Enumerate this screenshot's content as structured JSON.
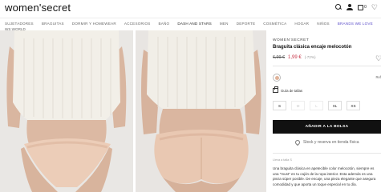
{
  "header": {
    "logo": "women'secret",
    "bag_count": "0"
  },
  "nav": {
    "items": [
      "SUJETADORES",
      "BRAGUITAS",
      "DORMIR Y HOMEWEAR",
      "ACCESORIOS",
      "BAÑO",
      "DASH AND STARS",
      "MEN",
      "DEPORTE",
      "COSMÉTICA",
      "HOGAR",
      "NIÑOS",
      "BRANDS WE LOVE"
    ],
    "second_line": "WS WORLD"
  },
  "product": {
    "brand": "WOMEN'SECRET",
    "title": "Braguita clásica encaje melocotón",
    "old_price": "6,99 €",
    "new_price": "1,99 €",
    "discount": "(-72%)",
    "ref": "Ref",
    "size_guide": "Guía de tallas",
    "sizes": [
      {
        "label": "S",
        "available": true
      },
      {
        "label": "M",
        "available": false
      },
      {
        "label": "L",
        "available": false
      },
      {
        "label": "XL",
        "available": true
      },
      {
        "label": "XS",
        "available": true
      }
    ],
    "add_button": "AÑADIR A LA BOLSA",
    "stock_link": "Stock y reserva en tienda física",
    "details_head": "Lleva a talla S",
    "description": "Una braguita clásica en apetecible color melocotón, siempre es una \"must\" en tu cajón de la ropa interior. Esta además es una pieza súper posible. De encaje, una pieza elegante que asegura comodidad y que aporta un toque especial en tu día."
  },
  "colors": {
    "accent": "#111111",
    "sale": "#c8374a",
    "brands_link": "#5a4cc9",
    "swatch": "#e0b39a"
  },
  "icons": {
    "search": "search-icon",
    "user": "user-icon",
    "bag": "bag-icon",
    "wishlist": "heart-icon"
  }
}
